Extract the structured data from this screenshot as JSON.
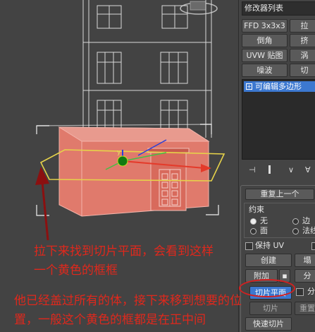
{
  "panel": {
    "dropdown_label": "修改器列表",
    "buttons": {
      "ffd": "FFD 3x3x3",
      "ffd2": "拉",
      "bevel": "倒角",
      "bevel2": "挤",
      "uvw": "UVW 贴图",
      "uvw2": "涡",
      "noise": "噪波",
      "noise2": "切"
    },
    "stack_item": "可编辑多边形",
    "rollout_title": "重复上一个",
    "constraints": {
      "group_label": "约束",
      "none": "无",
      "edge": "边",
      "face": "面",
      "normal": "法线"
    },
    "preserve_uv": "保持 UV",
    "create": "创建",
    "create2": "塌",
    "attach": "附加",
    "attach2": "分",
    "slice_plane": "切片平面",
    "slice_plane2": "分",
    "slice": "切片",
    "slice2": "重置",
    "quickslice": "快速切片"
  },
  "annotations": {
    "line1": "拉下来找到切片平面，会看到这样",
    "line2": "一个黄色的框框",
    "line3": "他已经盖过所有的体，接下来移到想要的位",
    "line4": "置，一般这个黄色的框都是在正中间"
  },
  "colors": {
    "annotation_red": "#e0281c",
    "selected_face": "#e07a6c",
    "slice_plane": "#e6d24a",
    "highlight_ring": "#d42020",
    "selection_blue": "#3c78d0"
  }
}
